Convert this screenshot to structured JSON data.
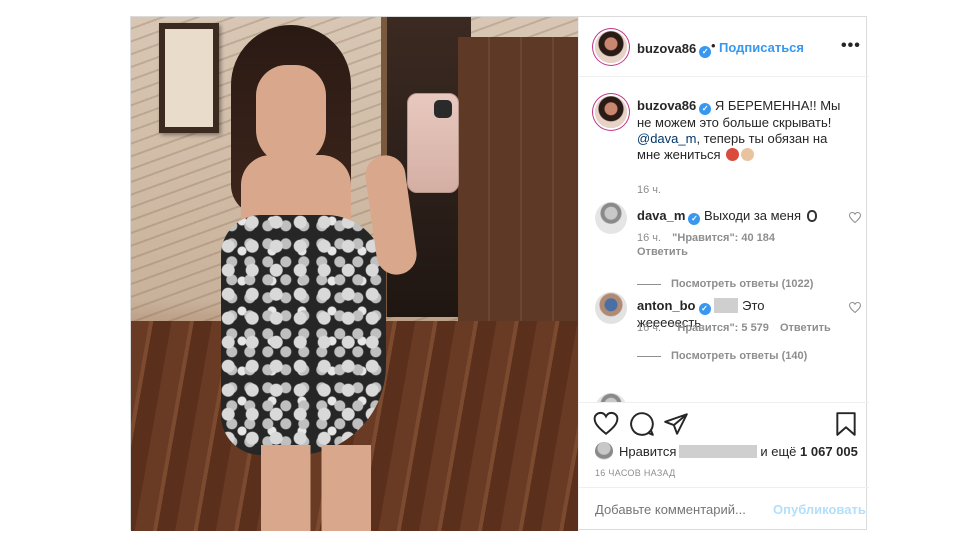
{
  "post": {
    "author": {
      "username": "buzova86",
      "follow_label": "Подписаться",
      "separator": "•",
      "more_label": "•••"
    },
    "caption": {
      "username": "buzova86",
      "text_1": "Я БЕРЕМЕННА!! Мы не можем это больше скрывать!",
      "mention": "@dava_m",
      "text_2": ", теперь ты обязан на мне жениться",
      "time": "16 ч."
    },
    "comments": [
      {
        "username": "dava_m",
        "text": "Выходи за меня",
        "time": "16 ч.",
        "likes": "\"Нравится\": 40 184",
        "reply_label": "Ответить",
        "view_replies": "Посмотреть ответы (1022)"
      },
      {
        "username": "anton_bo",
        "text": "Это жееееесть",
        "time": "16 ч.",
        "likes": "\"Нравится\": 5 579",
        "reply_label": "Ответить",
        "view_replies": "Посмотреть ответы (140)"
      }
    ],
    "likes": {
      "prefix": "Нравится",
      "suffix": "и ещё",
      "count": "1 067 005"
    },
    "time_ago": "16 ЧАСОВ НАЗАД",
    "add_comment": {
      "placeholder": "Добавьте комментарий...",
      "publish_label": "Опубликовать"
    },
    "icons": [
      "heart-icon",
      "comment-icon",
      "share-icon",
      "bookmark-icon",
      "verified-icon",
      "more-icon"
    ],
    "colors": {
      "link": "#3897f0",
      "verified": "#3897f0",
      "meta": "#8e8e8e",
      "publish_disabled": "#b2dffc",
      "border": "#dbdbdb"
    }
  }
}
